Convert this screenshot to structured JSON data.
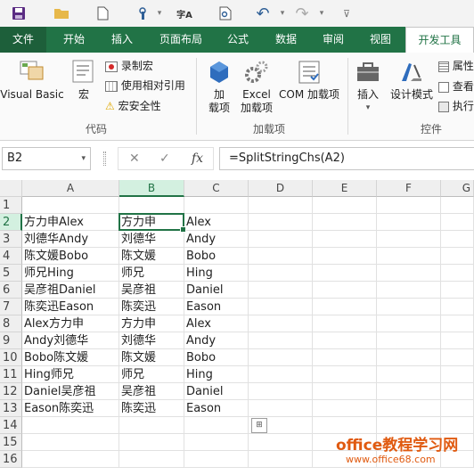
{
  "quick_access": {
    "icons": [
      "save-icon",
      "open-folder-icon",
      "new-file-icon",
      "touch-mode-icon",
      "spelling-icon",
      "print-preview-icon",
      "undo-icon",
      "redo-icon",
      "customize-icon"
    ],
    "spelling_glyph": "字A"
  },
  "tabs": [
    {
      "label": "文件"
    },
    {
      "label": "开始"
    },
    {
      "label": "插入"
    },
    {
      "label": "页面布局"
    },
    {
      "label": "公式"
    },
    {
      "label": "数据"
    },
    {
      "label": "审阅"
    },
    {
      "label": "视图"
    },
    {
      "label": "开发工具"
    }
  ],
  "ribbon": {
    "code": {
      "group_label": "代码",
      "visual_basic": "Visual Basic",
      "macros": "宏",
      "record_macro": "录制宏",
      "relative_ref": "使用相对引用",
      "macro_security": "宏安全性"
    },
    "addins": {
      "group_label": "加载项",
      "addins_line1": "加",
      "addins_line2": "载项",
      "excel_addins_line1": "Excel",
      "excel_addins_line2": "加载项",
      "com_addins": "COM 加载项"
    },
    "controls": {
      "group_label": "控件",
      "insert": "插入",
      "design_mode": "设计模式",
      "properties": "属性",
      "view_code": "查看",
      "run_dialog": "执行"
    }
  },
  "formula_bar": {
    "name_box": "B2",
    "formula": "=SplitStringChs(A2)",
    "cancel": "✕",
    "enter": "✓",
    "fx": "fx"
  },
  "grid": {
    "columns": [
      "A",
      "B",
      "C",
      "D",
      "E",
      "F",
      "G"
    ],
    "rows": [
      "1",
      "2",
      "3",
      "4",
      "5",
      "6",
      "7",
      "8",
      "9",
      "10",
      "11",
      "12",
      "13",
      "14",
      "15",
      "16"
    ],
    "data": [
      [
        "",
        "",
        ""
      ],
      [
        "方力申Alex",
        "方力申",
        "Alex"
      ],
      [
        "刘德华Andy",
        "刘德华",
        "Andy"
      ],
      [
        "陈文媛Bobo",
        "陈文媛",
        "Bobo"
      ],
      [
        "师兄Hing",
        "师兄",
        "Hing"
      ],
      [
        "吴彦祖Daniel",
        "吴彦祖",
        "Daniel"
      ],
      [
        "陈奕迅Eason",
        "陈奕迅",
        "Eason"
      ],
      [
        "Alex方力申",
        "方力申",
        "Alex"
      ],
      [
        "Andy刘德华",
        "刘德华",
        "Andy"
      ],
      [
        "Bobo陈文媛",
        "陈文媛",
        "Bobo"
      ],
      [
        "Hing师兄",
        "师兄",
        "Hing"
      ],
      [
        "Daniel吴彦祖",
        "吴彦祖",
        "Daniel"
      ],
      [
        "Eason陈奕迅",
        "陈奕迅",
        "Eason"
      ]
    ]
  },
  "watermark": {
    "title": "office教程学习网",
    "url": "www.office68.com"
  }
}
